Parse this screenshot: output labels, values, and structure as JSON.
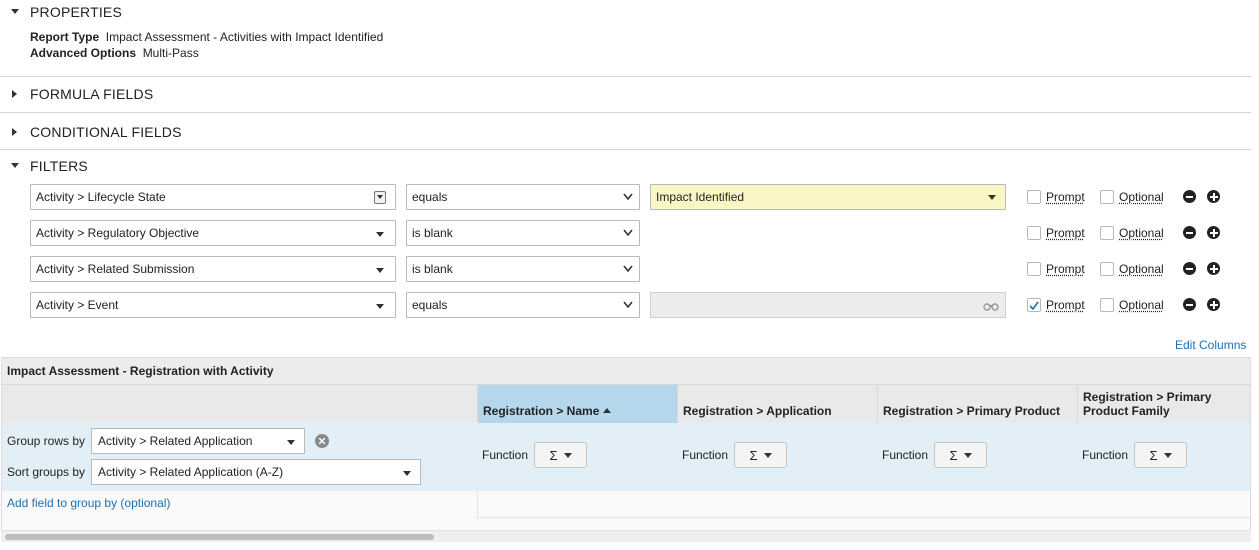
{
  "sections": {
    "properties": {
      "title": "PROPERTIES",
      "expanded": true
    },
    "formula_fields": {
      "title": "FORMULA FIELDS",
      "expanded": false
    },
    "conditional_fields": {
      "title": "CONDITIONAL FIELDS",
      "expanded": false
    },
    "filters": {
      "title": "FILTERS",
      "expanded": true
    }
  },
  "properties": {
    "report_type_label": "Report Type",
    "report_type_value": "Impact Assessment - Activities with Impact Identified",
    "advanced_options_label": "Advanced Options",
    "advanced_options_value": "Multi-Pass"
  },
  "filters": {
    "prompt_label": "Prompt",
    "optional_label": "Optional",
    "rows": [
      {
        "field": "Activity > Lifecycle State",
        "operator": "equals",
        "value": "Impact Identified",
        "prompt": false,
        "optional": false
      },
      {
        "field": "Activity > Regulatory Objective",
        "operator": "is blank",
        "value": "",
        "prompt": false,
        "optional": false
      },
      {
        "field": "Activity > Related Submission",
        "operator": "is blank",
        "value": "",
        "prompt": false,
        "optional": false
      },
      {
        "field": "Activity > Event",
        "operator": "equals",
        "value": "",
        "prompt": true,
        "optional": false
      }
    ]
  },
  "edit_columns_label": "Edit Columns",
  "grid": {
    "title": "Impact Assessment - Registration with Activity",
    "columns": [
      {
        "label": "Registration > Name",
        "sort": "asc",
        "function_label": "Function",
        "function_symbol": "Σ"
      },
      {
        "label": "Registration > Application",
        "function_label": "Function",
        "function_symbol": "Σ"
      },
      {
        "label": "Registration > Primary Product",
        "function_label": "Function",
        "function_symbol": "Σ"
      },
      {
        "label": "Registration > Primary Product Family",
        "function_label": "Function",
        "function_symbol": "Σ"
      }
    ],
    "group_rows_label": "Group rows by",
    "group_rows_value": "Activity > Related Application",
    "sort_groups_label": "Sort groups by",
    "sort_groups_value": "Activity > Related Application (A-Z)",
    "add_group_label": "Add field to group by (optional)"
  },
  "colors": {
    "accent_link": "#1f6fb0",
    "highlight_field": "#fbf7c4",
    "active_column": "#b5d7eb",
    "band": "#e3eff7"
  }
}
